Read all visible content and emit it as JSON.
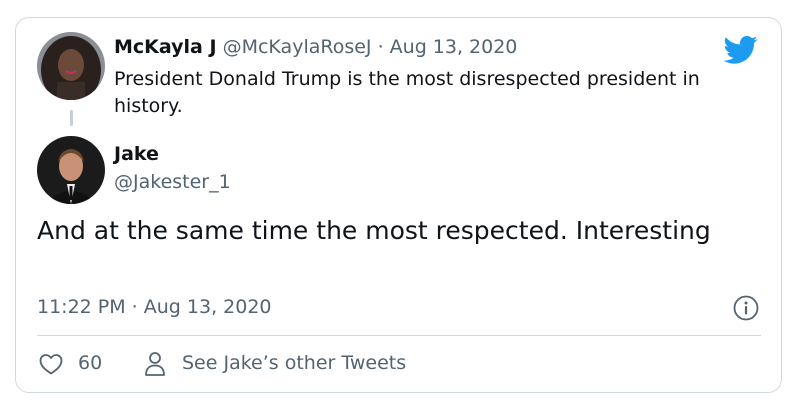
{
  "parent_tweet": {
    "name": "McKayla J",
    "meta": "@McKaylaRoseJ · Aug 13, 2020",
    "text": "President Donald Trump is the most disrespected president in history."
  },
  "reply_tweet": {
    "name": "Jake",
    "handle": "@Jakester_1",
    "text": "And at the same time the most respected. Interesting",
    "timestamp": "11:22 PM · Aug 13, 2020"
  },
  "actions": {
    "like_count": "60",
    "other_tweets_label": "See Jake’s other Tweets"
  },
  "icons": {
    "brand": "twitter-bird-icon",
    "info": "info-icon",
    "like": "heart-icon",
    "profile": "person-icon"
  },
  "colors": {
    "brand_blue": "#1d9bf0",
    "secondary_text": "#536471",
    "primary_text": "#0f1419",
    "border": "#cfd9de"
  }
}
